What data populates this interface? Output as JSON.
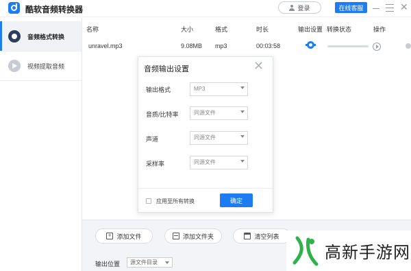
{
  "app": {
    "title": "酷软音频转换器",
    "login_label": "登录",
    "service_label": "在线客服"
  },
  "sidebar": {
    "items": [
      {
        "label": "音频格式转换",
        "icon": "audio-convert-icon",
        "active": true
      },
      {
        "label": "视频提取音频",
        "icon": "video-extract-icon",
        "active": false
      }
    ]
  },
  "table": {
    "headers": [
      "名称",
      "大小",
      "格式",
      "时长",
      "输出设置",
      "转换状态",
      "操作"
    ],
    "rows": [
      {
        "name": "unravel.mp3",
        "size": "9.08MB",
        "format": "mp3",
        "duration": "00:03:58",
        "progress": 0.0
      }
    ]
  },
  "dialog": {
    "title": "音频输出设置",
    "fields": [
      {
        "label": "输出格式",
        "value": "MP3"
      },
      {
        "label": "音质/比特率",
        "value": "同源文件"
      },
      {
        "label": "声道",
        "value": "同源文件"
      },
      {
        "label": "采样率",
        "value": "同源文件"
      }
    ],
    "apply_all_label": "应用至所有转换",
    "confirm_label": "确定"
  },
  "bottom": {
    "add_file_label": "添加文件",
    "add_folder_label": "添加文件夹",
    "clear_list_label": "清空列表",
    "output_label": "输出位置",
    "output_value": "源文件目录"
  },
  "watermark": {
    "text": "高新手游网"
  },
  "colors": {
    "accent": "#1e7cf2",
    "watermark_green": "#2fb24a"
  }
}
